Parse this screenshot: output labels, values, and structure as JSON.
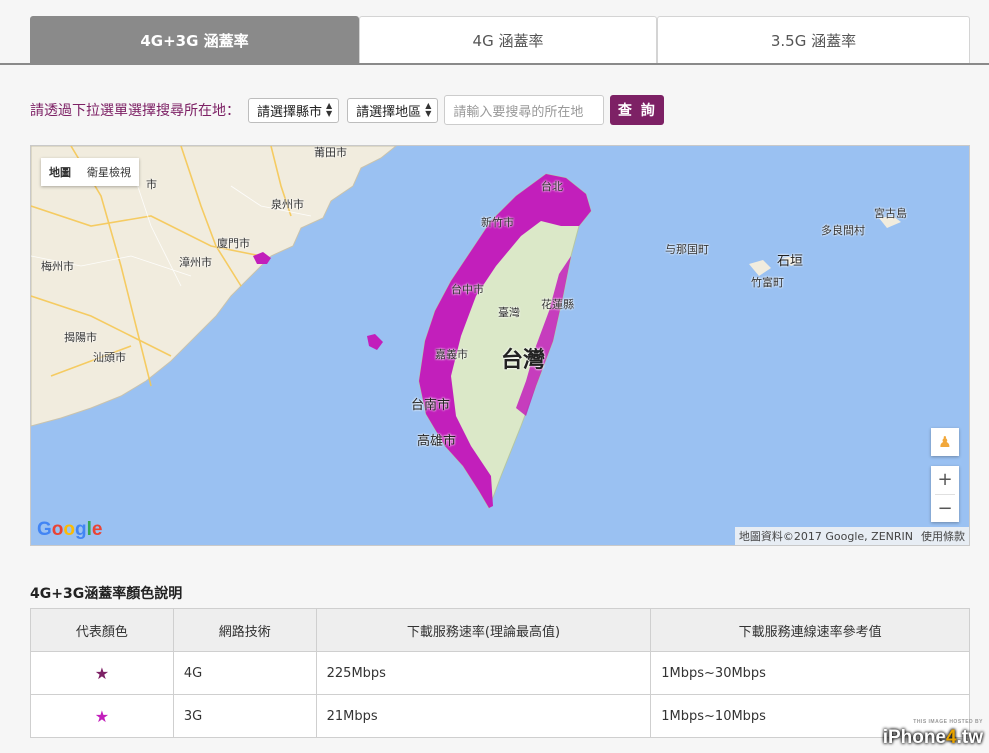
{
  "tabs": [
    {
      "label": "4G+3G 涵蓋率",
      "active": true
    },
    {
      "label": "4G 涵蓋率",
      "active": false
    },
    {
      "label": "3.5G 涵蓋率",
      "active": false
    }
  ],
  "search": {
    "label": "請透過下拉選單選擇搜尋所在地：",
    "city_select": "請選擇縣市",
    "district_select": "請選擇地區",
    "placeholder": "請輸入要搜尋的所在地",
    "button": "查 詢"
  },
  "map": {
    "type_buttons": [
      "地圖",
      "衛星檢視"
    ],
    "attribution": "地圖資料©2017 Google, ZENRIN",
    "terms": "使用條款",
    "logo": "Google",
    "labels": {
      "taiwan": "台灣",
      "taipei": "台北",
      "hsinchu": "新竹市",
      "taichung": "台中市",
      "nantou": "臺灣",
      "hualien": "花蓮縣",
      "chiayi": "嘉義市",
      "tainan": "台南市",
      "kaohsiung": "高雄市",
      "quanzhou": "泉州市",
      "xiamen": "廈門市",
      "zhangzhou": "漳州市",
      "meizhou": "梅州市",
      "jieyang": "揭陽市",
      "shantou": "汕頭市",
      "putian": "莆田市",
      "city_cut": "市",
      "yonaguni": "与那国町",
      "ishigaki": "石垣",
      "taketomi": "竹富町",
      "tarama": "多良間村",
      "miyako": "宮古島"
    },
    "colors": {
      "water": "#9ac1f2",
      "land_cn": "#f1ecde",
      "taiwan_land": "#dbe8c8",
      "coverage": "#c21fbb"
    }
  },
  "legend": {
    "title": "4G+3G涵蓋率顏色說明",
    "headers": [
      "代表顏色",
      "網路技術",
      "下載服務速率(理論最高值)",
      "下載服務連線速率參考值"
    ],
    "rows": [
      {
        "star": "★",
        "star_color": "#7d2165",
        "tech": "4G",
        "max": "225Mbps",
        "ref": "1Mbps~30Mbps"
      },
      {
        "star": "★",
        "star_color": "#c21fbb",
        "tech": "3G",
        "max": "21Mbps",
        "ref": "1Mbps~10Mbps"
      }
    ]
  },
  "watermark": {
    "text_a": "iPhone",
    "text_b": "4",
    "text_c": ".tw",
    "small": "THIS IMAGE HOSTED BY"
  }
}
